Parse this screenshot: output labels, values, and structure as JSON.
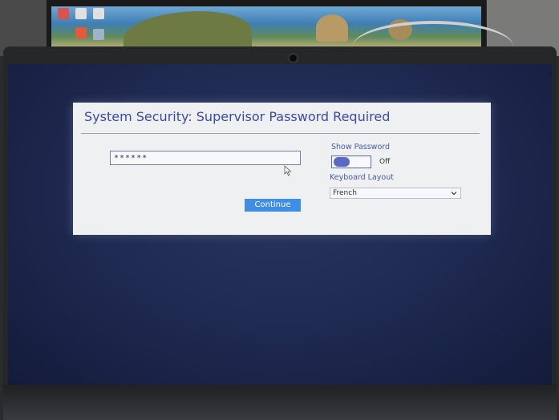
{
  "dialog": {
    "title": "System Security: Supervisor Password Required",
    "password": {
      "value": "******"
    },
    "show_password": {
      "label": "Show Password",
      "state": "Off"
    },
    "keyboard_layout": {
      "label": "Keyboard Layout",
      "selected": "French"
    },
    "continue_label": "Continue"
  },
  "colors": {
    "title": "#3b4aa8",
    "button": "#3f8ee6",
    "toggle": "#5a69c4",
    "dialog_bg": "#eef0f2",
    "screen_bg": "#1f2a52"
  },
  "icons": {
    "mouse": "mouse-pointer-icon",
    "dropdown": "chevron-down-icon"
  }
}
